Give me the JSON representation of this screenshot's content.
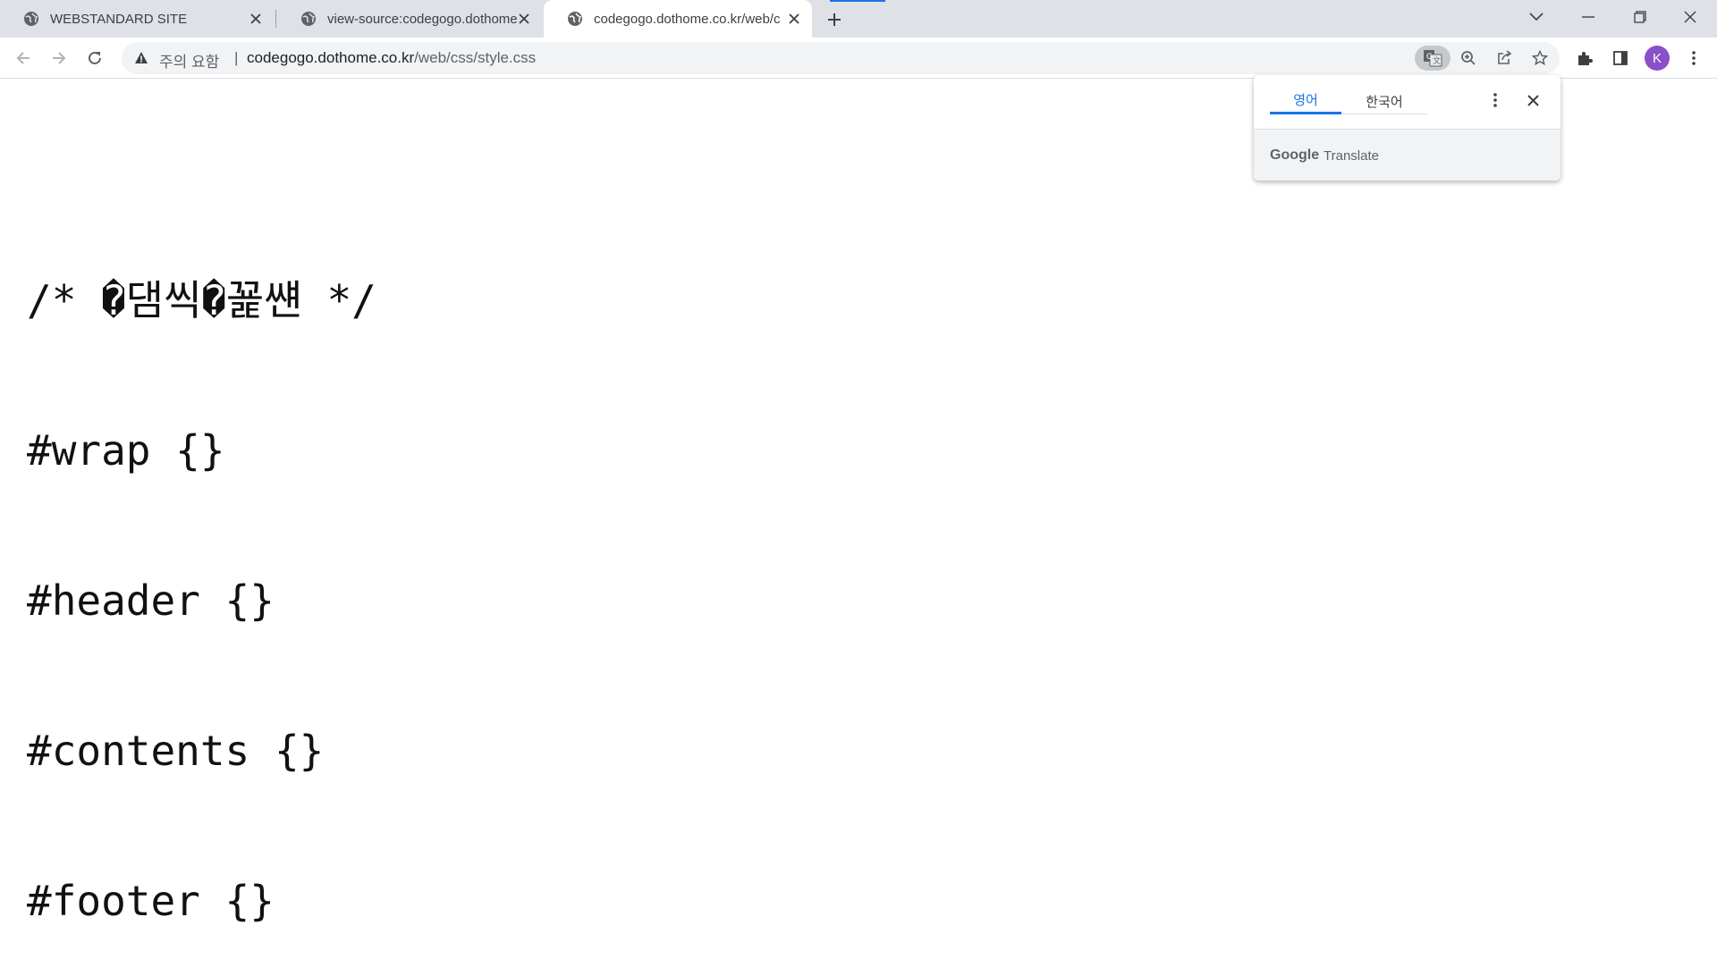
{
  "tabs": [
    {
      "title": "WEBSTANDARD SITE",
      "active": false
    },
    {
      "title": "view-source:codegogo.dothome",
      "active": false
    },
    {
      "title": "codegogo.dothome.co.kr/web/c",
      "active": true
    }
  ],
  "toolbar": {
    "security_label": "주의 요함",
    "separator": "|",
    "url_host": "codegogo.dothome.co.kr",
    "url_path": "/web/css/style.css"
  },
  "profile": {
    "initial": "K",
    "color": "#8a4fc9"
  },
  "page": {
    "lines": [
      "/* �댐씩�꾩썐 */",
      "#wrap {}",
      "#header {}",
      "#contents {}",
      "#footer {}"
    ]
  },
  "translate_bubble": {
    "source_lang": "영어",
    "target_lang": "한국어",
    "brand_google": "Google",
    "brand_translate": "Translate"
  },
  "icons": {
    "favicon": "globe-icon",
    "tab_close": "close-icon",
    "new_tab": "plus-icon",
    "back": "arrow-left-icon",
    "forward": "arrow-right-icon",
    "reload": "reload-icon",
    "warning": "warning-triangle-icon",
    "translate": "translate-icon",
    "zoom": "zoom-icon",
    "share": "share-icon",
    "bookmark": "star-icon",
    "extensions": "puzzle-icon",
    "side_panel": "side-panel-icon",
    "menu": "kebab-menu-icon"
  },
  "colors": {
    "accent": "#1a73e8",
    "tabstrip": "#dee1e6"
  }
}
